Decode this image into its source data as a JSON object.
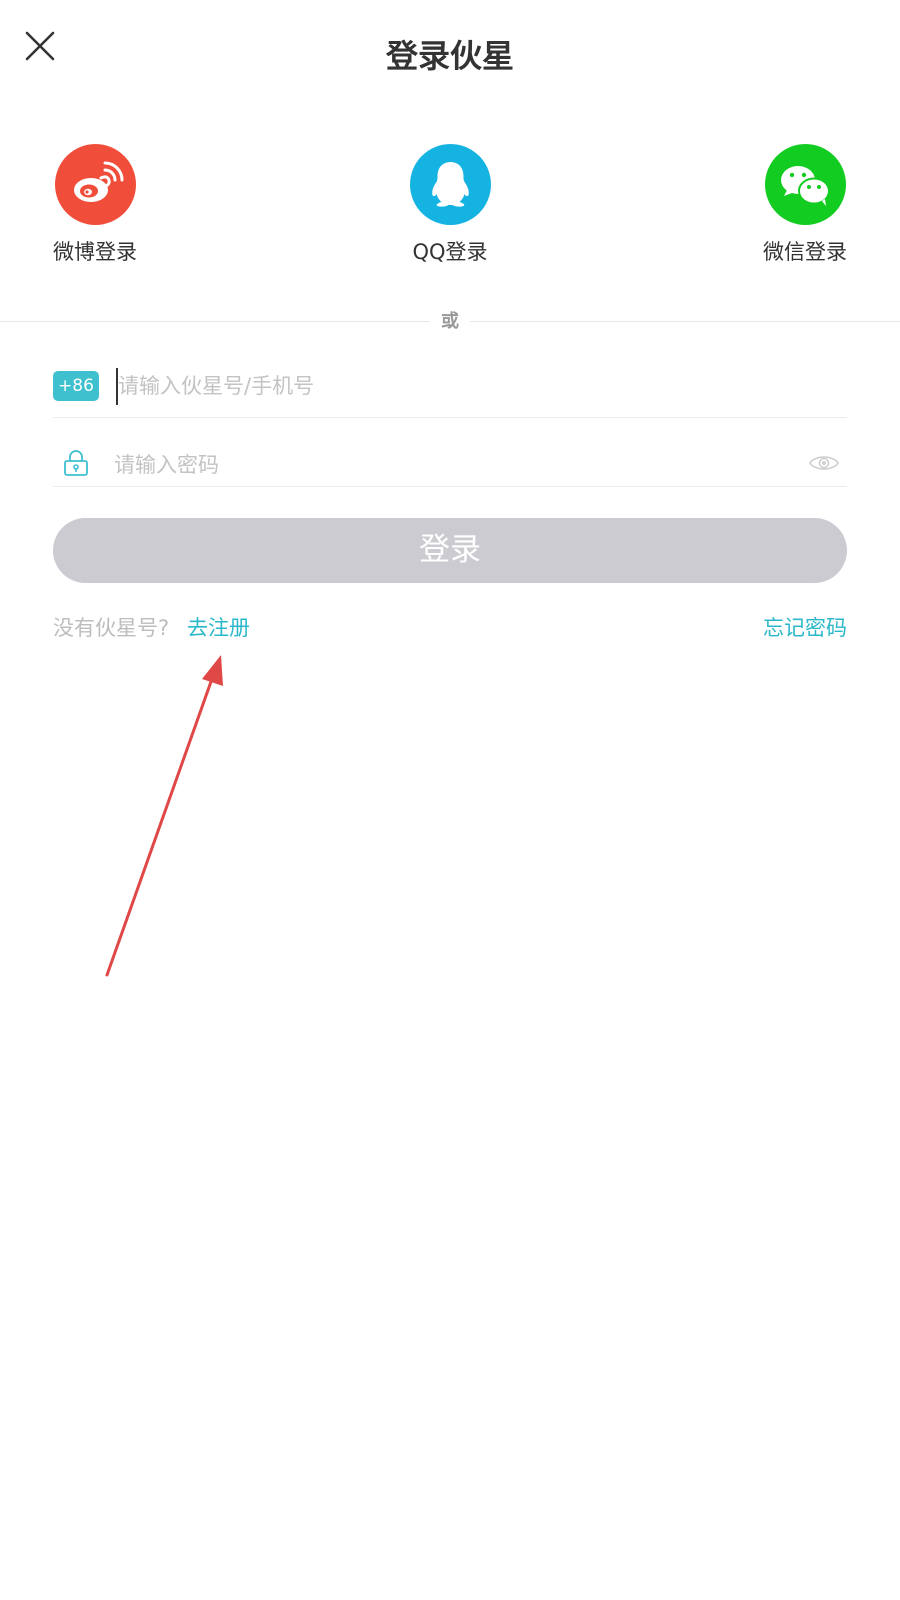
{
  "header": {
    "title": "登录伙星",
    "close_icon": "close-icon"
  },
  "social_login": [
    {
      "id": "weibo",
      "label": "微博登录",
      "icon": "weibo-icon",
      "color": "#f14d3b"
    },
    {
      "id": "qq",
      "label": "QQ登录",
      "icon": "qq-penguin-icon",
      "color": "#15b3e2"
    },
    {
      "id": "wechat",
      "label": "微信登录",
      "icon": "wechat-icon",
      "color": "#13cc21"
    }
  ],
  "divider": {
    "text": "或"
  },
  "form": {
    "country_code": "+86",
    "phone_placeholder": "请输入伙星号/手机号",
    "phone_value": "",
    "password_placeholder": "请输入密码",
    "password_value": "",
    "lock_icon": "lock-icon",
    "eye_icon": "eye-icon",
    "login_label": "登录"
  },
  "footer_links": {
    "no_account_text": "没有伙星号?",
    "register_label": "去注册",
    "forgot_label": "忘记密码"
  },
  "colors": {
    "accent": "#2bb8c9",
    "country_code_bg": "#3ec0cf",
    "login_button_disabled": "#cccbd2",
    "annotation_arrow": "#e04848"
  }
}
